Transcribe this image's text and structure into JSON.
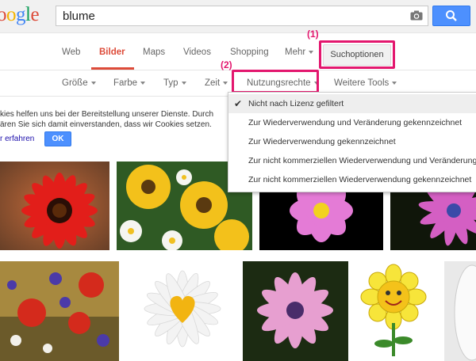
{
  "header": {
    "logo_letters": [
      "o",
      "o",
      "g",
      "l",
      "e"
    ],
    "search_query": "blume"
  },
  "tabs": [
    "Web",
    "Bilder",
    "Maps",
    "Videos",
    "Shopping",
    "Mehr"
  ],
  "tools_button": "Suchoptionen",
  "annotations": [
    "(1)",
    "(2)"
  ],
  "filters": [
    "Größe",
    "Farbe",
    "Typ",
    "Zeit",
    "Nutzungsrechte",
    "Weitere Tools"
  ],
  "usage_rights_options": [
    "Nicht nach Lizenz gefiltert",
    "Zur Wiederverwendung und Veränderung gekennzeichnet",
    "Zur Wiederverwendung gekennzeichnet",
    "Zur nicht kommerziellen Wiederverwendung und Veränderung",
    "Zur nicht kommerziellen Wiederverwendung gekennzeichnet"
  ],
  "cookie": {
    "line1": "kies helfen uns bei der Bereitstellung unserer Dienste. Durch",
    "line2": "ären Sie sich damit einverstanden, dass wir Cookies setzen.",
    "link": "r erfahren",
    "ok": "OK"
  },
  "colors": {
    "accent_red": "#dd4b39",
    "blue": "#4d90fe",
    "highlight": "#e3176e"
  }
}
